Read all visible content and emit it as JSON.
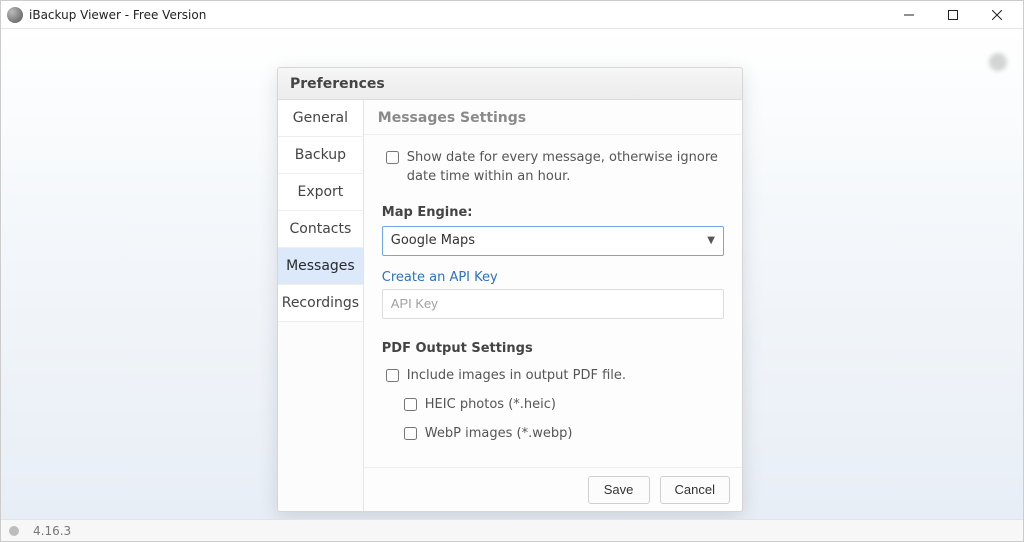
{
  "window": {
    "title": "iBackup Viewer - Free Version"
  },
  "dialog": {
    "title": "Preferences",
    "tabs": [
      {
        "label": "General"
      },
      {
        "label": "Backup"
      },
      {
        "label": "Export"
      },
      {
        "label": "Contacts"
      },
      {
        "label": "Messages",
        "active": true
      },
      {
        "label": "Recordings"
      }
    ],
    "panel": {
      "title": "Messages Settings",
      "show_date_label": "Show date for every message, otherwise ignore date time within an hour.",
      "show_date_checked": false,
      "map_section_label": "Map Engine:",
      "map_engine_value": "Google Maps",
      "api_key_link": "Create an API Key",
      "api_key_placeholder": "API Key",
      "api_key_value": "",
      "pdf_section_label": "PDF Output Settings",
      "include_images_label": "Include images in output PDF file.",
      "include_images_checked": false,
      "heic_label": "HEIC photos (*.heic)",
      "heic_checked": false,
      "webp_label": "WebP images (*.webp)",
      "webp_checked": false
    },
    "save_label": "Save",
    "cancel_label": "Cancel"
  },
  "statusbar": {
    "version": "4.16.3"
  }
}
